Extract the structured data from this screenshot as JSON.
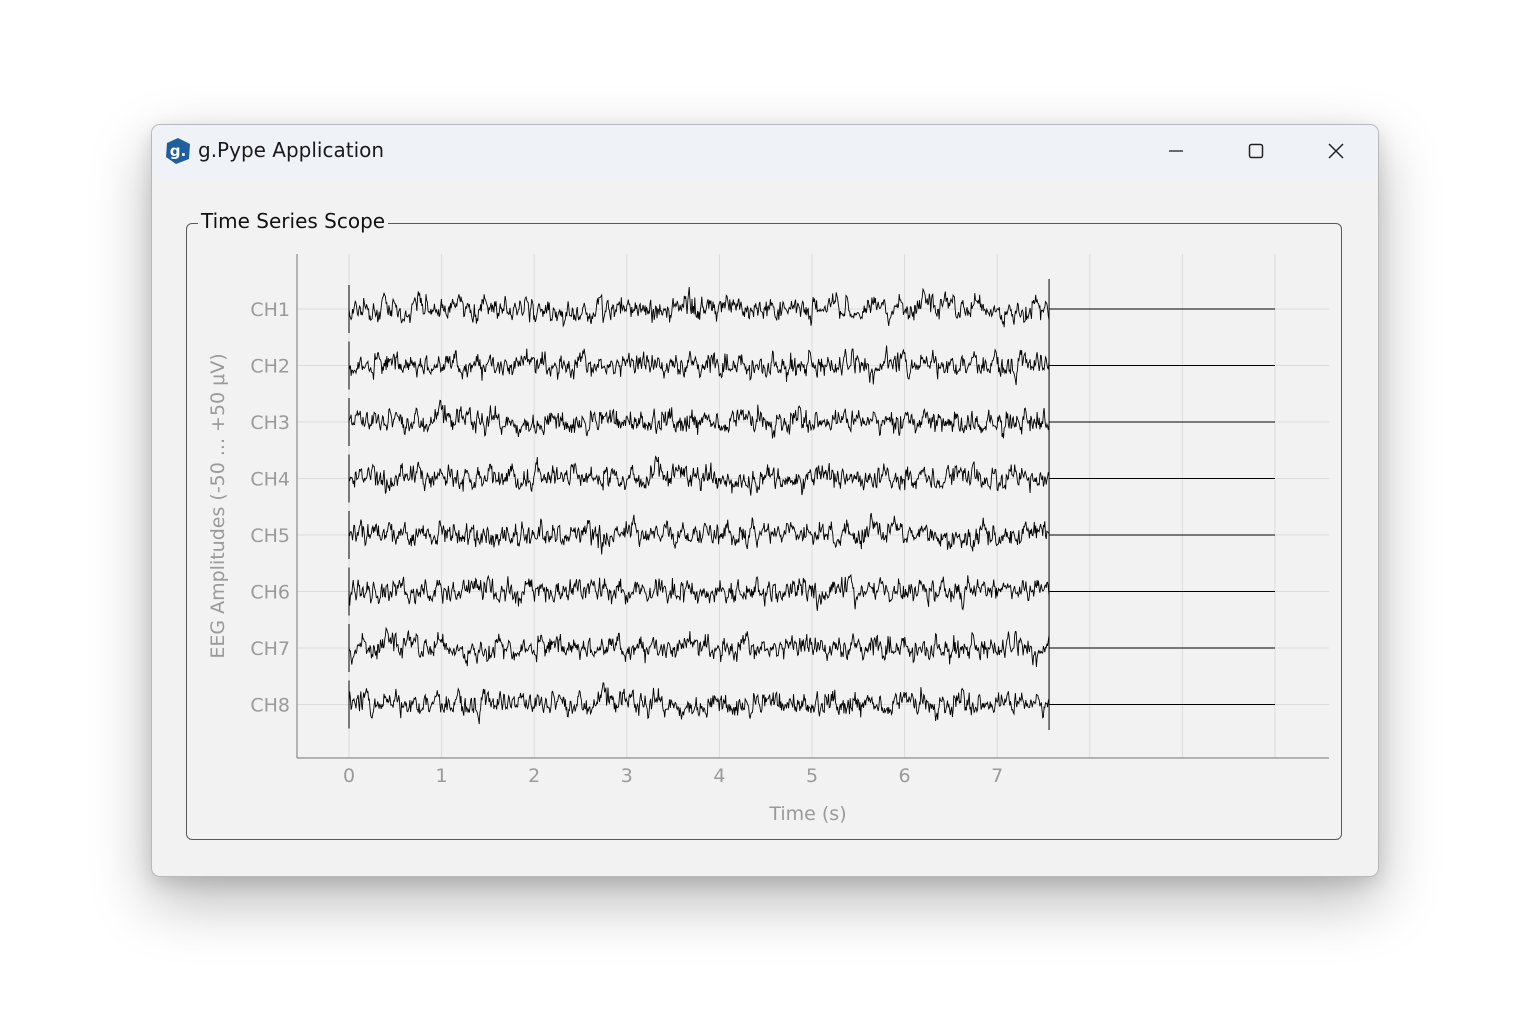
{
  "window": {
    "title": "g.Pype Application",
    "icon": "g-logo-icon",
    "buttons": [
      "minimize-icon",
      "maximize-icon",
      "close-icon"
    ]
  },
  "scope": {
    "group_title": "Time Series Scope"
  },
  "colors": {
    "signal": "#000000",
    "grid": "#dcdcdc",
    "axis": "#8c8c8c",
    "label": "#9a9a9a",
    "logo": "#1f5f9e"
  },
  "chart_data": {
    "type": "line",
    "xlabel": "Time (s)",
    "ylabel": "EEG Amplitudes (-50 ... +50 μV)",
    "x_ticks": [
      "0",
      "1",
      "2",
      "3",
      "4",
      "5",
      "6",
      "7"
    ],
    "xlim": [
      -0.57,
      10.55
    ],
    "data_end_time": 7.56,
    "display_end_time": 10.0,
    "grid": true,
    "series": [
      {
        "name": "CH1"
      },
      {
        "name": "CH2"
      },
      {
        "name": "CH3"
      },
      {
        "name": "CH4"
      },
      {
        "name": "CH5"
      },
      {
        "name": "CH6"
      },
      {
        "name": "CH7"
      },
      {
        "name": "CH8"
      }
    ]
  }
}
